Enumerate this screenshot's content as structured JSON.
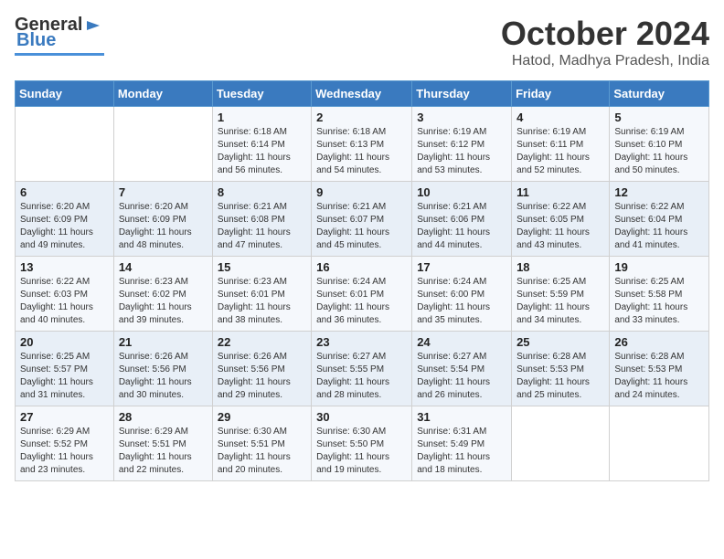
{
  "header": {
    "logo": {
      "general": "General",
      "blue": "Blue"
    },
    "title": "October 2024",
    "subtitle": "Hatod, Madhya Pradesh, India"
  },
  "days_of_week": [
    "Sunday",
    "Monday",
    "Tuesday",
    "Wednesday",
    "Thursday",
    "Friday",
    "Saturday"
  ],
  "weeks": [
    [
      {
        "day": "",
        "info": ""
      },
      {
        "day": "",
        "info": ""
      },
      {
        "day": "1",
        "info": "Sunrise: 6:18 AM\nSunset: 6:14 PM\nDaylight: 11 hours and 56 minutes."
      },
      {
        "day": "2",
        "info": "Sunrise: 6:18 AM\nSunset: 6:13 PM\nDaylight: 11 hours and 54 minutes."
      },
      {
        "day": "3",
        "info": "Sunrise: 6:19 AM\nSunset: 6:12 PM\nDaylight: 11 hours and 53 minutes."
      },
      {
        "day": "4",
        "info": "Sunrise: 6:19 AM\nSunset: 6:11 PM\nDaylight: 11 hours and 52 minutes."
      },
      {
        "day": "5",
        "info": "Sunrise: 6:19 AM\nSunset: 6:10 PM\nDaylight: 11 hours and 50 minutes."
      }
    ],
    [
      {
        "day": "6",
        "info": "Sunrise: 6:20 AM\nSunset: 6:09 PM\nDaylight: 11 hours and 49 minutes."
      },
      {
        "day": "7",
        "info": "Sunrise: 6:20 AM\nSunset: 6:09 PM\nDaylight: 11 hours and 48 minutes."
      },
      {
        "day": "8",
        "info": "Sunrise: 6:21 AM\nSunset: 6:08 PM\nDaylight: 11 hours and 47 minutes."
      },
      {
        "day": "9",
        "info": "Sunrise: 6:21 AM\nSunset: 6:07 PM\nDaylight: 11 hours and 45 minutes."
      },
      {
        "day": "10",
        "info": "Sunrise: 6:21 AM\nSunset: 6:06 PM\nDaylight: 11 hours and 44 minutes."
      },
      {
        "day": "11",
        "info": "Sunrise: 6:22 AM\nSunset: 6:05 PM\nDaylight: 11 hours and 43 minutes."
      },
      {
        "day": "12",
        "info": "Sunrise: 6:22 AM\nSunset: 6:04 PM\nDaylight: 11 hours and 41 minutes."
      }
    ],
    [
      {
        "day": "13",
        "info": "Sunrise: 6:22 AM\nSunset: 6:03 PM\nDaylight: 11 hours and 40 minutes."
      },
      {
        "day": "14",
        "info": "Sunrise: 6:23 AM\nSunset: 6:02 PM\nDaylight: 11 hours and 39 minutes."
      },
      {
        "day": "15",
        "info": "Sunrise: 6:23 AM\nSunset: 6:01 PM\nDaylight: 11 hours and 38 minutes."
      },
      {
        "day": "16",
        "info": "Sunrise: 6:24 AM\nSunset: 6:01 PM\nDaylight: 11 hours and 36 minutes."
      },
      {
        "day": "17",
        "info": "Sunrise: 6:24 AM\nSunset: 6:00 PM\nDaylight: 11 hours and 35 minutes."
      },
      {
        "day": "18",
        "info": "Sunrise: 6:25 AM\nSunset: 5:59 PM\nDaylight: 11 hours and 34 minutes."
      },
      {
        "day": "19",
        "info": "Sunrise: 6:25 AM\nSunset: 5:58 PM\nDaylight: 11 hours and 33 minutes."
      }
    ],
    [
      {
        "day": "20",
        "info": "Sunrise: 6:25 AM\nSunset: 5:57 PM\nDaylight: 11 hours and 31 minutes."
      },
      {
        "day": "21",
        "info": "Sunrise: 6:26 AM\nSunset: 5:56 PM\nDaylight: 11 hours and 30 minutes."
      },
      {
        "day": "22",
        "info": "Sunrise: 6:26 AM\nSunset: 5:56 PM\nDaylight: 11 hours and 29 minutes."
      },
      {
        "day": "23",
        "info": "Sunrise: 6:27 AM\nSunset: 5:55 PM\nDaylight: 11 hours and 28 minutes."
      },
      {
        "day": "24",
        "info": "Sunrise: 6:27 AM\nSunset: 5:54 PM\nDaylight: 11 hours and 26 minutes."
      },
      {
        "day": "25",
        "info": "Sunrise: 6:28 AM\nSunset: 5:53 PM\nDaylight: 11 hours and 25 minutes."
      },
      {
        "day": "26",
        "info": "Sunrise: 6:28 AM\nSunset: 5:53 PM\nDaylight: 11 hours and 24 minutes."
      }
    ],
    [
      {
        "day": "27",
        "info": "Sunrise: 6:29 AM\nSunset: 5:52 PM\nDaylight: 11 hours and 23 minutes."
      },
      {
        "day": "28",
        "info": "Sunrise: 6:29 AM\nSunset: 5:51 PM\nDaylight: 11 hours and 22 minutes."
      },
      {
        "day": "29",
        "info": "Sunrise: 6:30 AM\nSunset: 5:51 PM\nDaylight: 11 hours and 20 minutes."
      },
      {
        "day": "30",
        "info": "Sunrise: 6:30 AM\nSunset: 5:50 PM\nDaylight: 11 hours and 19 minutes."
      },
      {
        "day": "31",
        "info": "Sunrise: 6:31 AM\nSunset: 5:49 PM\nDaylight: 11 hours and 18 minutes."
      },
      {
        "day": "",
        "info": ""
      },
      {
        "day": "",
        "info": ""
      }
    ]
  ]
}
